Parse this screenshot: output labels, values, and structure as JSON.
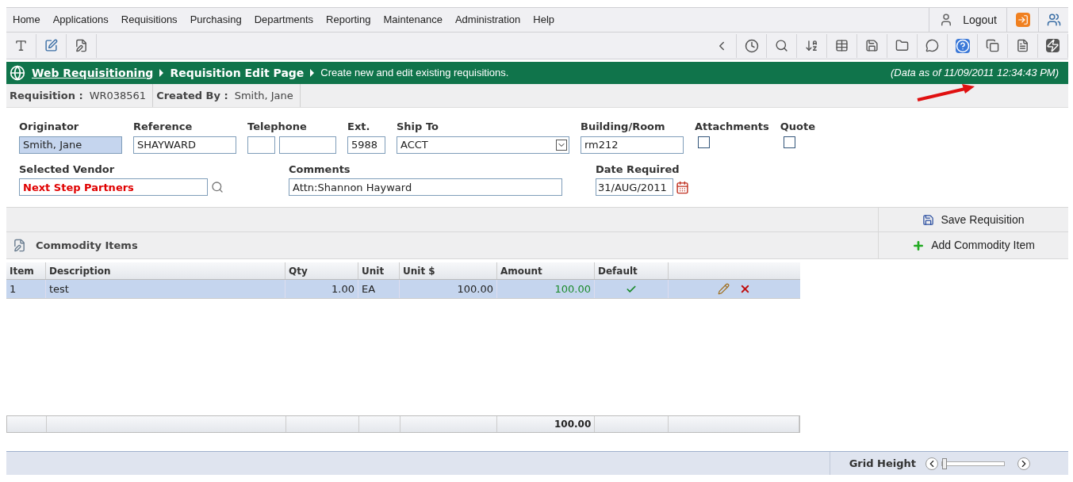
{
  "menu": {
    "items": [
      "Home",
      "Applications",
      "Requisitions",
      "Purchasing",
      "Departments",
      "Reporting",
      "Maintenance",
      "Administration",
      "Help"
    ],
    "logout": "Logout"
  },
  "header": {
    "app_link": "Web Requisitioning",
    "page": "Requisition Edit Page",
    "description": "Create new and edit existing requisitions.",
    "data_as_of": "(Data as of 11/09/2011 12:34:43 PM)"
  },
  "info": [
    {
      "label": "Requisition :",
      "value": "WR038561"
    },
    {
      "label": "Created By :",
      "value": "Smith, Jane"
    }
  ],
  "form": {
    "row1": [
      {
        "kind": "text",
        "label": "Originator",
        "value": "Smith, Jane",
        "readonly": true
      },
      {
        "kind": "text",
        "label": "Reference",
        "value": "SHAYWARD",
        "readonly": false
      },
      {
        "kind": "phone",
        "label": "Telephone"
      },
      {
        "kind": "text",
        "label": "Ext.",
        "value": "5988",
        "readonly": false
      },
      {
        "kind": "select",
        "label": "Ship To",
        "value": "ACCT"
      },
      {
        "kind": "text",
        "label": "Building/Room",
        "value": "rm212",
        "readonly": false
      },
      {
        "kind": "checkbox",
        "label": "Attachments",
        "checked": false
      },
      {
        "kind": "checkbox",
        "label": "Quote",
        "checked": false
      }
    ],
    "vendor": {
      "label": "Selected Vendor",
      "value": "Next Step Partners"
    },
    "comments": {
      "label": "Comments",
      "value": "Attn:Shannon Hayward"
    },
    "date": {
      "label": "Date Required",
      "value": "31/AUG/2011"
    }
  },
  "save_button": "Save Requisition",
  "section_title": "Commodity Items",
  "add_button": "Add Commodity Item",
  "grid": {
    "columns": [
      "Item",
      "Description",
      "Qty",
      "Unit",
      "Unit $",
      "Amount",
      "Default"
    ],
    "rows": [
      {
        "item": "1",
        "description": "test",
        "qty": "1.00",
        "unit": "EA",
        "unit_price": "100.00",
        "amount": "100.00",
        "default": true,
        "selected": true
      }
    ],
    "total": "100.00"
  },
  "footer": {
    "label": "Grid Height",
    "level": 0
  }
}
